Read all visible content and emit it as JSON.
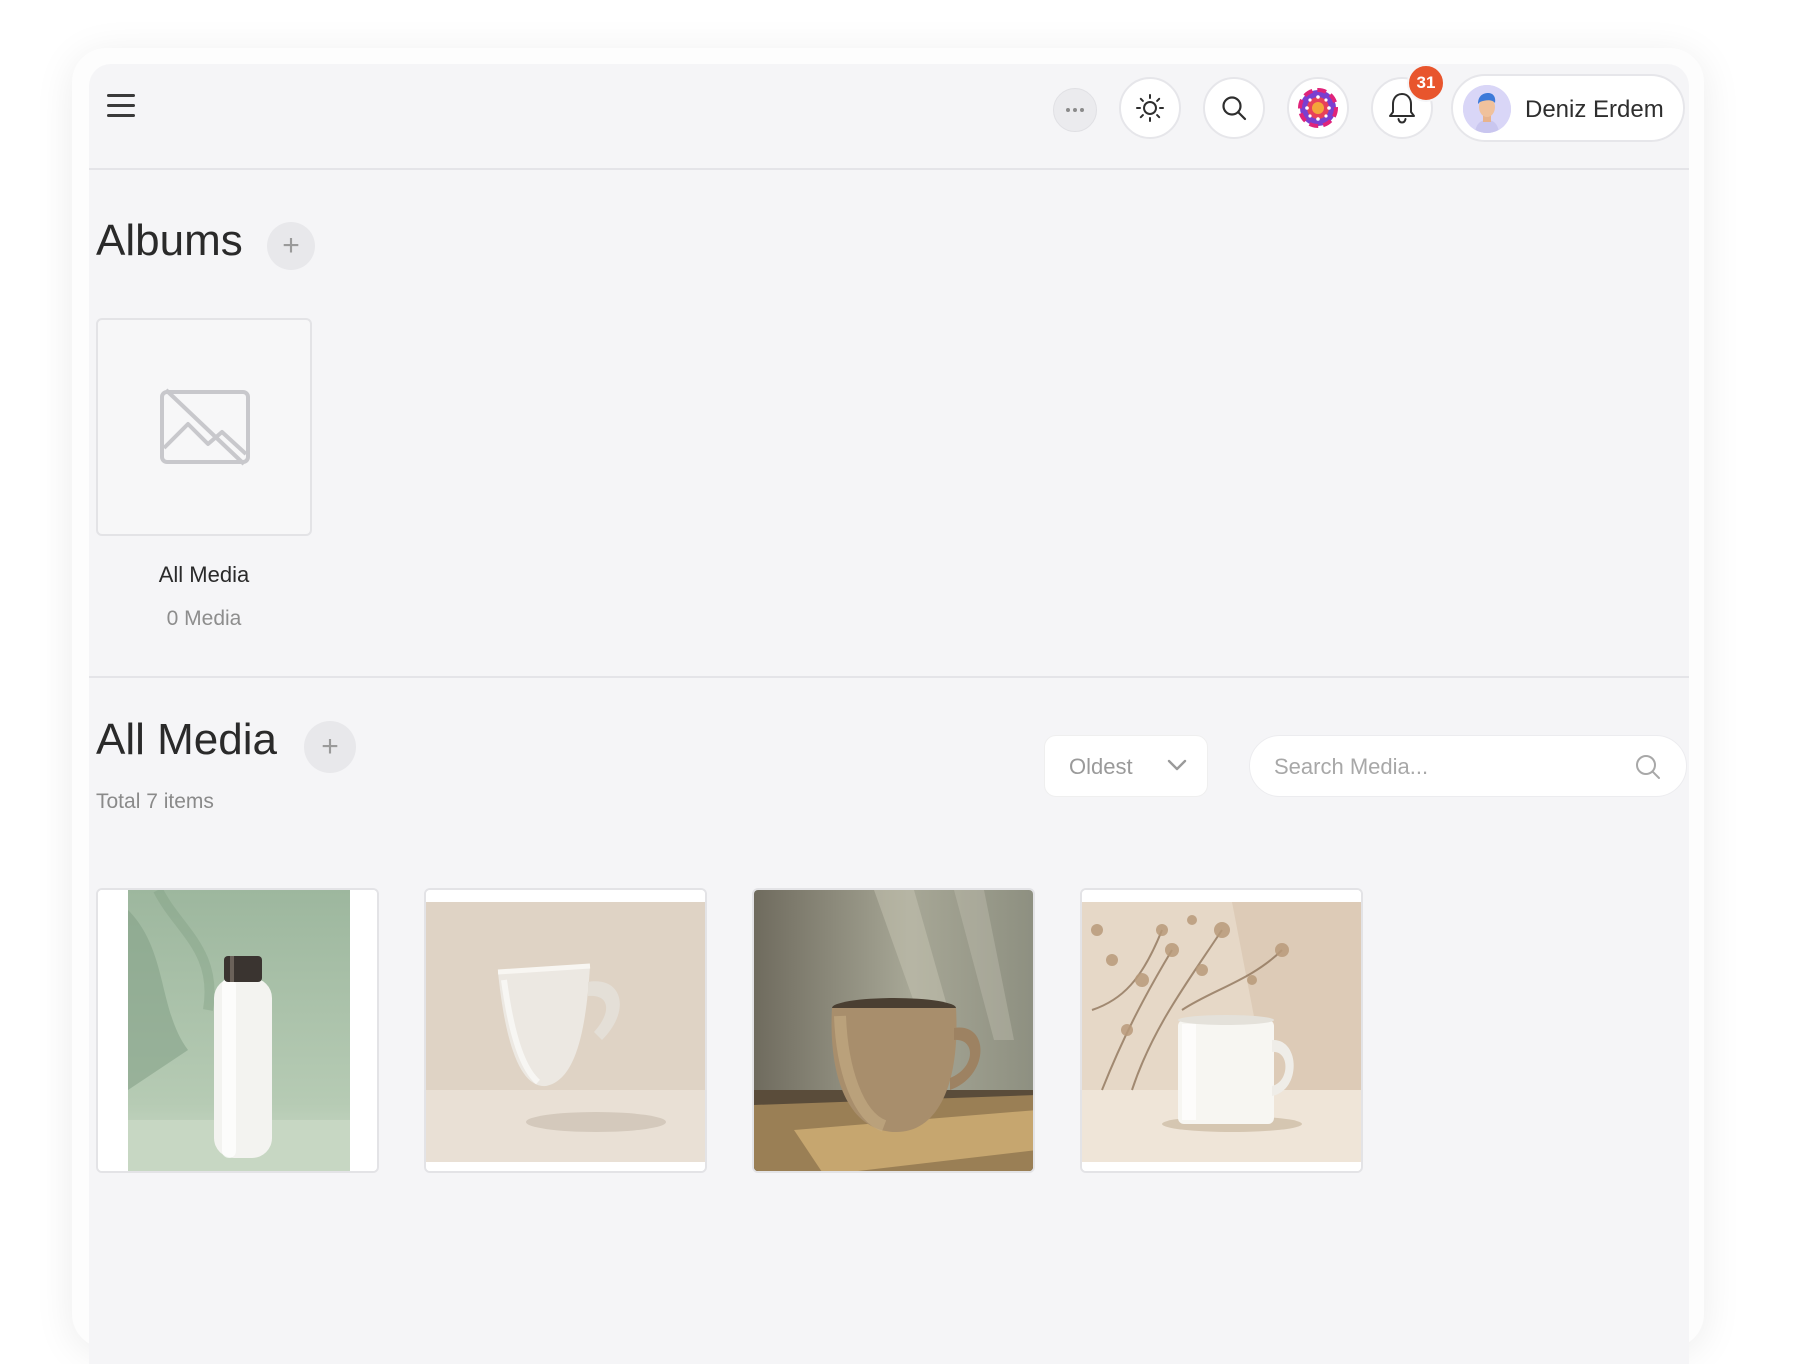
{
  "header": {
    "user_name": "Deniz Erdem",
    "notification_count": "31"
  },
  "albums": {
    "title": "Albums",
    "add_symbol": "+",
    "items": [
      {
        "name": "All Media",
        "count": "0 Media"
      }
    ]
  },
  "media": {
    "title": "All Media",
    "add_symbol": "+",
    "total": "Total 7 items",
    "sort_value": "Oldest",
    "search_placeholder": "Search Media...",
    "items": [
      {
        "subject": "white water bottle on green background"
      },
      {
        "subject": "white ceramic mug on beige background"
      },
      {
        "subject": "speckled beige ceramic mug in sunlight"
      },
      {
        "subject": "white mug with dried flowers"
      }
    ]
  },
  "icons": [
    "menu-icon",
    "more-icon",
    "sun-icon",
    "search-icon",
    "app-logo-icon",
    "bell-icon",
    "image-placeholder-icon",
    "chevron-down-icon"
  ],
  "colors": {
    "badge": "#e8552d",
    "background": "#f5f5f7"
  }
}
